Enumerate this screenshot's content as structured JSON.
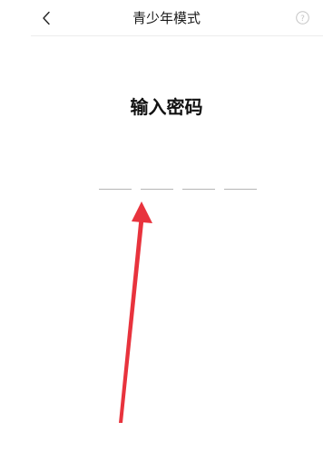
{
  "header": {
    "title": "青少年模式",
    "back_icon": "chevron-left-icon",
    "help_icon": "question-circle-icon"
  },
  "main": {
    "title": "输入密码",
    "pin_length": 4
  },
  "annotation": {
    "arrow_color": "#e8333d"
  }
}
